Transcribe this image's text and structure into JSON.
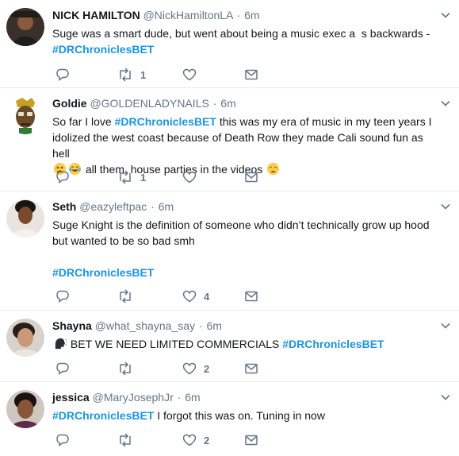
{
  "colors": {
    "accent": "#1b95e0",
    "muted": "#657786",
    "text": "#14171a",
    "divider": "#e6ecf0"
  },
  "tweets": [
    {
      "name": "NICK HAMILTON",
      "handle": "@NickHamiltonLA",
      "time": "6m",
      "text_before": "Suge was a smart dude, but went about being a music exec a  s backwards -",
      "hashtag": "#DRChroniclesBET",
      "retweets": "1",
      "likes": ""
    },
    {
      "name": "Goldie",
      "handle": "@GOLDENLADYNAILS",
      "time": "6m",
      "text_before": "So far I love ",
      "hashtag": "#DRChroniclesBET",
      "text_after": " this was my era of music in my teen years I idolized the west coast because of Death Row they made Cali sound fun as hell",
      "text_line3": " all them  house parties in the videos ",
      "emojis": [
        "tired-face-emoji",
        "tears-of-joy-emoji",
        "weary-face-emoji"
      ],
      "retweets": "1",
      "likes": ""
    },
    {
      "name": "Seth",
      "handle": "@eazyleftpac",
      "time": "6m",
      "text_before": "Suge Knight is the definition of someone who didn’t technically grow up hood but wanted to be so bad smh",
      "hashtag": "#DRChroniclesBET",
      "retweets": "",
      "likes": "4"
    },
    {
      "name": "Shayna",
      "handle": "@what_shayna_say",
      "time": "6m",
      "text_before": " BET WE NEED LIMITED COMMERCIALS ",
      "hashtag": "#DRChroniclesBET",
      "emojis": [
        "speaking-head-emoji"
      ],
      "retweets": "",
      "likes": "2"
    },
    {
      "name": "jessica",
      "handle": "@MaryJosephJr",
      "time": "6m",
      "hashtag": "#DRChroniclesBET",
      "text_after": " I forgot this was on. Tuning in now",
      "retweets": "",
      "likes": "2"
    }
  ]
}
